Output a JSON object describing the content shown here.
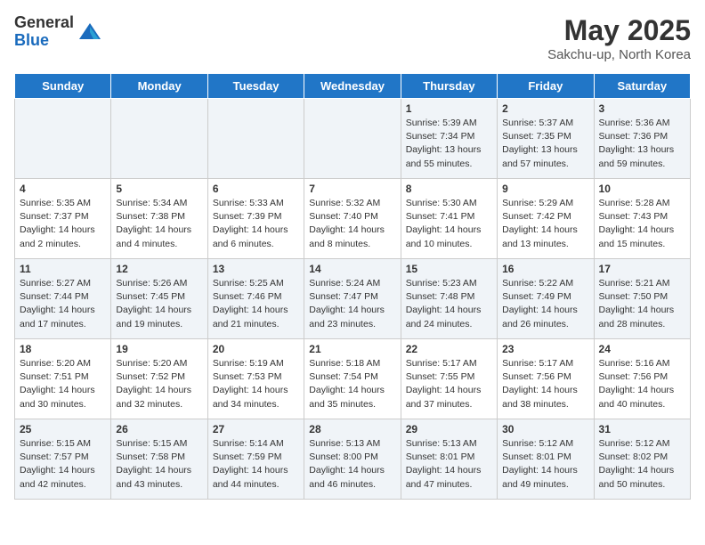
{
  "header": {
    "logo_general": "General",
    "logo_blue": "Blue",
    "title": "May 2025",
    "subtitle": "Sakchu-up, North Korea"
  },
  "days_of_week": [
    "Sunday",
    "Monday",
    "Tuesday",
    "Wednesday",
    "Thursday",
    "Friday",
    "Saturday"
  ],
  "weeks": [
    [
      {
        "day": "",
        "info": ""
      },
      {
        "day": "",
        "info": ""
      },
      {
        "day": "",
        "info": ""
      },
      {
        "day": "",
        "info": ""
      },
      {
        "day": "1",
        "info": "Sunrise: 5:39 AM\nSunset: 7:34 PM\nDaylight: 13 hours\nand 55 minutes."
      },
      {
        "day": "2",
        "info": "Sunrise: 5:37 AM\nSunset: 7:35 PM\nDaylight: 13 hours\nand 57 minutes."
      },
      {
        "day": "3",
        "info": "Sunrise: 5:36 AM\nSunset: 7:36 PM\nDaylight: 13 hours\nand 59 minutes."
      }
    ],
    [
      {
        "day": "4",
        "info": "Sunrise: 5:35 AM\nSunset: 7:37 PM\nDaylight: 14 hours\nand 2 minutes."
      },
      {
        "day": "5",
        "info": "Sunrise: 5:34 AM\nSunset: 7:38 PM\nDaylight: 14 hours\nand 4 minutes."
      },
      {
        "day": "6",
        "info": "Sunrise: 5:33 AM\nSunset: 7:39 PM\nDaylight: 14 hours\nand 6 minutes."
      },
      {
        "day": "7",
        "info": "Sunrise: 5:32 AM\nSunset: 7:40 PM\nDaylight: 14 hours\nand 8 minutes."
      },
      {
        "day": "8",
        "info": "Sunrise: 5:30 AM\nSunset: 7:41 PM\nDaylight: 14 hours\nand 10 minutes."
      },
      {
        "day": "9",
        "info": "Sunrise: 5:29 AM\nSunset: 7:42 PM\nDaylight: 14 hours\nand 13 minutes."
      },
      {
        "day": "10",
        "info": "Sunrise: 5:28 AM\nSunset: 7:43 PM\nDaylight: 14 hours\nand 15 minutes."
      }
    ],
    [
      {
        "day": "11",
        "info": "Sunrise: 5:27 AM\nSunset: 7:44 PM\nDaylight: 14 hours\nand 17 minutes."
      },
      {
        "day": "12",
        "info": "Sunrise: 5:26 AM\nSunset: 7:45 PM\nDaylight: 14 hours\nand 19 minutes."
      },
      {
        "day": "13",
        "info": "Sunrise: 5:25 AM\nSunset: 7:46 PM\nDaylight: 14 hours\nand 21 minutes."
      },
      {
        "day": "14",
        "info": "Sunrise: 5:24 AM\nSunset: 7:47 PM\nDaylight: 14 hours\nand 23 minutes."
      },
      {
        "day": "15",
        "info": "Sunrise: 5:23 AM\nSunset: 7:48 PM\nDaylight: 14 hours\nand 24 minutes."
      },
      {
        "day": "16",
        "info": "Sunrise: 5:22 AM\nSunset: 7:49 PM\nDaylight: 14 hours\nand 26 minutes."
      },
      {
        "day": "17",
        "info": "Sunrise: 5:21 AM\nSunset: 7:50 PM\nDaylight: 14 hours\nand 28 minutes."
      }
    ],
    [
      {
        "day": "18",
        "info": "Sunrise: 5:20 AM\nSunset: 7:51 PM\nDaylight: 14 hours\nand 30 minutes."
      },
      {
        "day": "19",
        "info": "Sunrise: 5:20 AM\nSunset: 7:52 PM\nDaylight: 14 hours\nand 32 minutes."
      },
      {
        "day": "20",
        "info": "Sunrise: 5:19 AM\nSunset: 7:53 PM\nDaylight: 14 hours\nand 34 minutes."
      },
      {
        "day": "21",
        "info": "Sunrise: 5:18 AM\nSunset: 7:54 PM\nDaylight: 14 hours\nand 35 minutes."
      },
      {
        "day": "22",
        "info": "Sunrise: 5:17 AM\nSunset: 7:55 PM\nDaylight: 14 hours\nand 37 minutes."
      },
      {
        "day": "23",
        "info": "Sunrise: 5:17 AM\nSunset: 7:56 PM\nDaylight: 14 hours\nand 38 minutes."
      },
      {
        "day": "24",
        "info": "Sunrise: 5:16 AM\nSunset: 7:56 PM\nDaylight: 14 hours\nand 40 minutes."
      }
    ],
    [
      {
        "day": "25",
        "info": "Sunrise: 5:15 AM\nSunset: 7:57 PM\nDaylight: 14 hours\nand 42 minutes."
      },
      {
        "day": "26",
        "info": "Sunrise: 5:15 AM\nSunset: 7:58 PM\nDaylight: 14 hours\nand 43 minutes."
      },
      {
        "day": "27",
        "info": "Sunrise: 5:14 AM\nSunset: 7:59 PM\nDaylight: 14 hours\nand 44 minutes."
      },
      {
        "day": "28",
        "info": "Sunrise: 5:13 AM\nSunset: 8:00 PM\nDaylight: 14 hours\nand 46 minutes."
      },
      {
        "day": "29",
        "info": "Sunrise: 5:13 AM\nSunset: 8:01 PM\nDaylight: 14 hours\nand 47 minutes."
      },
      {
        "day": "30",
        "info": "Sunrise: 5:12 AM\nSunset: 8:01 PM\nDaylight: 14 hours\nand 49 minutes."
      },
      {
        "day": "31",
        "info": "Sunrise: 5:12 AM\nSunset: 8:02 PM\nDaylight: 14 hours\nand 50 minutes."
      }
    ]
  ]
}
